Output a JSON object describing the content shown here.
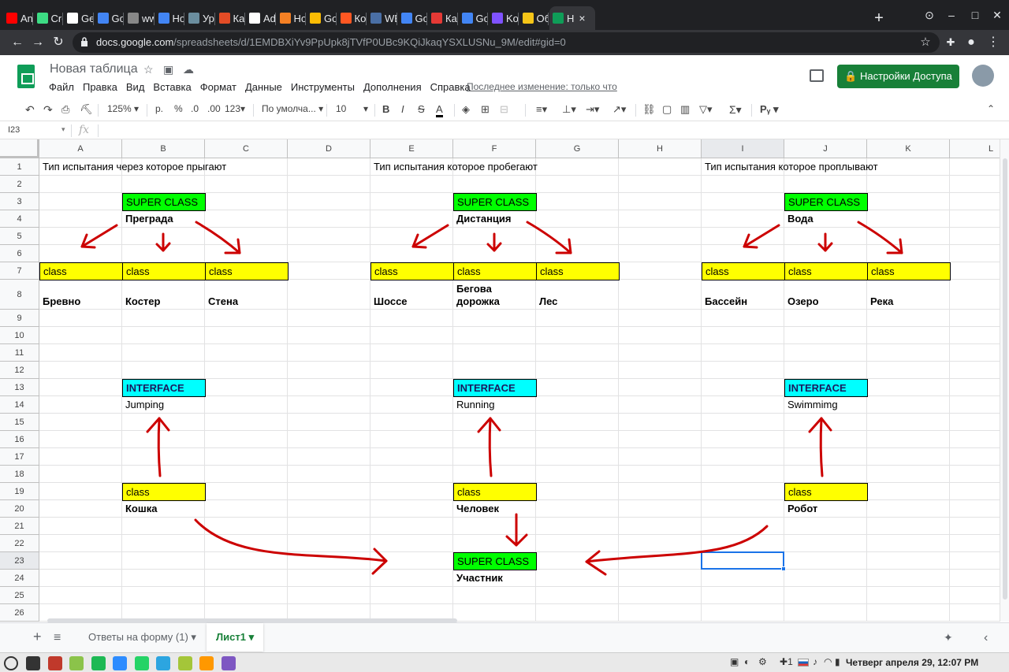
{
  "browser": {
    "tabs": [
      {
        "label": "And",
        "color": "#ff0000"
      },
      {
        "label": "Crea",
        "color": "#3ddc84"
      },
      {
        "label": "Get",
        "color": "#ffffff"
      },
      {
        "label": "Goo",
        "color": "#4285f4"
      },
      {
        "label": "www",
        "color": "#888888"
      },
      {
        "label": "Hon",
        "color": "#4285f4"
      },
      {
        "label": "Уро",
        "color": "#6b8e9f"
      },
      {
        "label": "Как",
        "color": "#e34c26"
      },
      {
        "label": "Add",
        "color": "#ffffff"
      },
      {
        "label": "How",
        "color": "#f48024"
      },
      {
        "label": "Goo",
        "color": "#fbbc04"
      },
      {
        "label": "Ком",
        "color": "#ff5722"
      },
      {
        "label": "WEE",
        "color": "#4a6fa5"
      },
      {
        "label": "Goo",
        "color": "#4285f4"
      },
      {
        "label": "Как",
        "color": "#e53935"
      },
      {
        "label": "Goo",
        "color": "#4285f4"
      },
      {
        "label": "Kotl",
        "color": "#7f52ff"
      },
      {
        "label": "Обс",
        "color": "#f5c518"
      },
      {
        "label": "Н",
        "color": "#0f9d58",
        "active": true
      }
    ],
    "new_tab": "+",
    "url_host": "docs.google.com",
    "url_path": "/spreadsheets/d/1EMDBXiYv9PpUpk8jTVfP0UBc9KQiJkaqYSXLUSNu_9M/edit#gid=0"
  },
  "doc": {
    "title": "Новая таблица",
    "menu": [
      "Файл",
      "Правка",
      "Вид",
      "Вставка",
      "Формат",
      "Данные",
      "Инструменты",
      "Дополнения",
      "Справка"
    ],
    "last_edit": "Последнее изменение: только что",
    "share_label": "Настройки Доступа"
  },
  "format_toolbar": {
    "zoom": "125%",
    "currency": "р.",
    "percent": "%",
    "dec_less": ".0",
    "dec_more": ".00",
    "number_format": "123",
    "font": "По умолча...",
    "font_size": "10"
  },
  "formula_bar": {
    "name_box": "I23",
    "fx": "fx"
  },
  "sheet": {
    "columns": [
      "A",
      "B",
      "C",
      "D",
      "E",
      "F",
      "G",
      "H",
      "I",
      "J",
      "K",
      "L"
    ],
    "rows": [
      "1",
      "2",
      "3",
      "4",
      "5",
      "6",
      "7",
      "8",
      "9",
      "10",
      "11",
      "12",
      "13",
      "14",
      "15",
      "16",
      "17",
      "18",
      "19",
      "20",
      "21",
      "22",
      "23",
      "24",
      "25",
      "26"
    ],
    "selected_cell": "I23",
    "cells": [
      {
        "ref": "A1",
        "text": "Тип испытания через которое прыгают",
        "style": "plain"
      },
      {
        "ref": "E1",
        "text": "Тип испытания которое пробегают",
        "style": "plain"
      },
      {
        "ref": "I1",
        "text": "Тип испытания которое проплывают",
        "style": "plain"
      },
      {
        "ref": "B3",
        "text": "SUPER CLASS",
        "style": "green"
      },
      {
        "ref": "F3",
        "text": "SUPER CLASS",
        "style": "green"
      },
      {
        "ref": "J3",
        "text": "SUPER CLASS",
        "style": "green"
      },
      {
        "ref": "B4",
        "text": "Преграда",
        "style": "bold"
      },
      {
        "ref": "F4",
        "text": "Дистанция",
        "style": "bold"
      },
      {
        "ref": "J4",
        "text": "Вода",
        "style": "bold"
      },
      {
        "ref": "A7",
        "text": "class",
        "style": "yellow"
      },
      {
        "ref": "B7",
        "text": "class",
        "style": "yellow"
      },
      {
        "ref": "C7",
        "text": "class",
        "style": "yellow"
      },
      {
        "ref": "E7",
        "text": "class",
        "style": "yellow"
      },
      {
        "ref": "F7",
        "text": "class",
        "style": "yellow"
      },
      {
        "ref": "G7",
        "text": "class",
        "style": "yellow"
      },
      {
        "ref": "I7",
        "text": "class",
        "style": "yellow"
      },
      {
        "ref": "J7",
        "text": "class",
        "style": "yellow"
      },
      {
        "ref": "K7",
        "text": "class",
        "style": "yellow"
      },
      {
        "ref": "A8",
        "text": "Бревно",
        "style": "bold"
      },
      {
        "ref": "B8",
        "text": "Костер",
        "style": "bold"
      },
      {
        "ref": "C8",
        "text": "Стена",
        "style": "bold"
      },
      {
        "ref": "E8",
        "text": "Шоссе",
        "style": "bold"
      },
      {
        "ref": "F8",
        "text": "Бегова\nдорожка",
        "style": "bold"
      },
      {
        "ref": "G8",
        "text": "Лес",
        "style": "bold"
      },
      {
        "ref": "I8",
        "text": "Бассейн",
        "style": "bold"
      },
      {
        "ref": "J8",
        "text": "Озеро",
        "style": "bold"
      },
      {
        "ref": "K8",
        "text": "Река",
        "style": "bold"
      },
      {
        "ref": "B13",
        "text": "INTERFACE",
        "style": "cyan"
      },
      {
        "ref": "F13",
        "text": "INTERFACE",
        "style": "cyan"
      },
      {
        "ref": "J13",
        "text": "INTERFACE",
        "style": "cyan"
      },
      {
        "ref": "B14",
        "text": "Jumping",
        "style": "plain"
      },
      {
        "ref": "F14",
        "text": "Running",
        "style": "plain"
      },
      {
        "ref": "J14",
        "text": "Swimmimg",
        "style": "plain"
      },
      {
        "ref": "B19",
        "text": "class",
        "style": "yellow"
      },
      {
        "ref": "F19",
        "text": "class",
        "style": "yellow"
      },
      {
        "ref": "J19",
        "text": "class",
        "style": "yellow"
      },
      {
        "ref": "B20",
        "text": "Кошка",
        "style": "bold"
      },
      {
        "ref": "F20",
        "text": "Человек",
        "style": "bold"
      },
      {
        "ref": "J20",
        "text": "Робот",
        "style": "bold"
      },
      {
        "ref": "F23",
        "text": "SUPER CLASS",
        "style": "green"
      },
      {
        "ref": "F24",
        "text": "Участник",
        "style": "bold"
      }
    ],
    "arrow_color": "#cc0000"
  },
  "sheet_tabs": {
    "tabs": [
      "Ответы на форму (1)",
      "Лист1"
    ],
    "active": "Лист1"
  },
  "taskbar": {
    "apps": [
      "#333333",
      "#c0392b",
      "#8bc34a",
      "#1db954",
      "#2d8cff",
      "#25d366",
      "#2ca5e0",
      "#a4c639",
      "#ff9800",
      "#7e57c2"
    ],
    "clock": "Четверг апреля 29, 12:07 PM",
    "tray_count": "1"
  }
}
